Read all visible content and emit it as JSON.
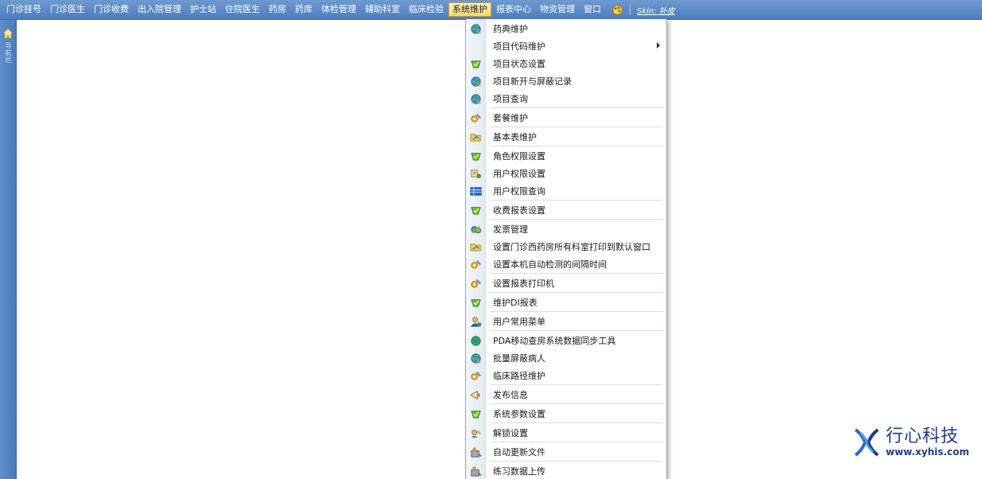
{
  "menubar": {
    "items": [
      {
        "label": "门诊挂号",
        "active": false
      },
      {
        "label": "门诊医生",
        "active": false
      },
      {
        "label": "门诊收费",
        "active": false
      },
      {
        "label": "出入院管理",
        "active": false
      },
      {
        "label": "护士站",
        "active": false
      },
      {
        "label": "住院医生",
        "active": false
      },
      {
        "label": "药房",
        "active": false
      },
      {
        "label": "药库",
        "active": false
      },
      {
        "label": "体检管理",
        "active": false
      },
      {
        "label": "辅助科室",
        "active": false
      },
      {
        "label": "临床检验",
        "active": false
      },
      {
        "label": "系统维护",
        "active": true
      },
      {
        "label": "报表中心",
        "active": false
      },
      {
        "label": "物资管理",
        "active": false
      },
      {
        "label": "窗口",
        "active": false
      }
    ],
    "skin_label": "Skin: 补皮"
  },
  "sidebar": {
    "label": "导航栏",
    "icon": "home-icon"
  },
  "dropdown": {
    "items": [
      {
        "label": "药典维护",
        "icon": "globe-icon",
        "submenu": false
      },
      {
        "label": "项目代码维护",
        "icon": "",
        "submenu": true
      },
      {
        "label": "项目状态设置",
        "icon": "check-leaf-icon",
        "submenu": false
      },
      {
        "label": "项目新开与屏蔽记录",
        "icon": "globe-icon",
        "submenu": false
      },
      {
        "label": "项目查询",
        "icon": "globe-icon",
        "submenu": false
      },
      {
        "label": "套餐维护",
        "icon": "tools-icon",
        "submenu": false
      },
      {
        "label": "基本表维护",
        "icon": "folder-icon",
        "submenu": false
      },
      {
        "label": "角色权限设置",
        "icon": "check-leaf-icon",
        "submenu": false
      },
      {
        "label": "用户权限设置",
        "icon": "user-tools-icon",
        "submenu": false
      },
      {
        "label": "用户权限查询",
        "icon": "table-icon",
        "submenu": false
      },
      {
        "label": "收费报表设置",
        "icon": "check-leaf-icon",
        "submenu": false
      },
      {
        "label": "发票管理",
        "icon": "invoice-icon",
        "submenu": false
      },
      {
        "label": "设置门诊西药房所有科室打印到默认窗口",
        "icon": "folder-icon",
        "submenu": false
      },
      {
        "label": "设置本机自动检测的间隔时间",
        "icon": "tools-icon",
        "submenu": false
      },
      {
        "label": "设置报表打印机",
        "icon": "tools-icon",
        "submenu": false
      },
      {
        "label": "维护DI报表",
        "icon": "check-leaf-icon",
        "submenu": false
      },
      {
        "label": "用户常用菜单",
        "icon": "user-icon",
        "submenu": false
      },
      {
        "label": "PDA移动查房系统数据同步工具",
        "icon": "sync-globe-icon",
        "submenu": false
      },
      {
        "label": "批量屏蔽病人",
        "icon": "globe-icon",
        "submenu": false
      },
      {
        "label": "临床路径维护",
        "icon": "tools-icon",
        "submenu": false
      },
      {
        "label": "发布信息",
        "icon": "megaphone-icon",
        "submenu": false
      },
      {
        "label": "系统参数设置",
        "icon": "check-leaf-icon",
        "submenu": false
      },
      {
        "label": "解锁设置",
        "icon": "unlock-icon",
        "submenu": false
      },
      {
        "label": "自动更新文件",
        "icon": "update-icon",
        "submenu": false
      },
      {
        "label": "练习数据上传",
        "icon": "update-icon",
        "submenu": false
      }
    ]
  },
  "watermark": {
    "name": "行心科技",
    "url": "www.xyhis.com"
  },
  "colors": {
    "menubar": "#5683c3",
    "active_menu": "#ffd76a",
    "watermark": "#1f3c88"
  }
}
